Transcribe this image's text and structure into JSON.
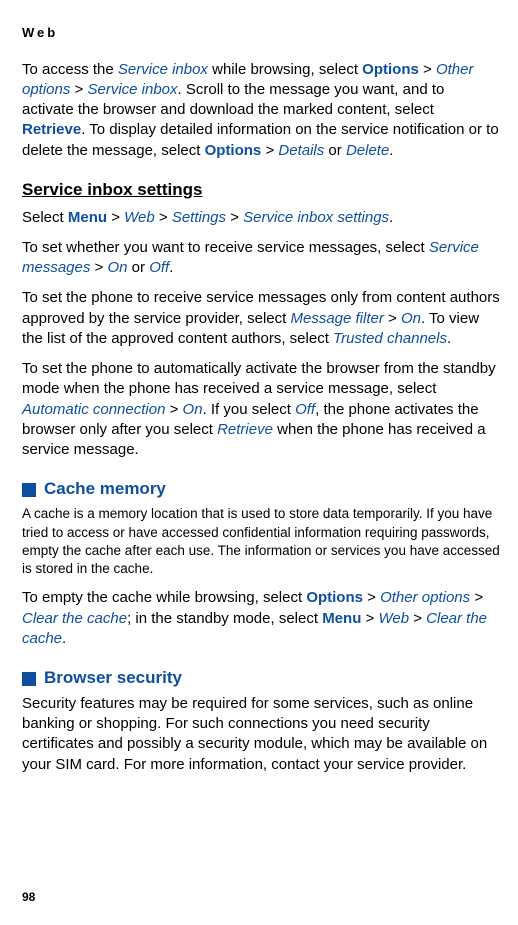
{
  "header": "Web",
  "p1": {
    "t1": "To access the ",
    "link1": "Service inbox",
    "t2": " while browsing, select ",
    "opt": "Options",
    "gt": " > ",
    "link2": "Other options",
    "link3": "Service inbox",
    "t3": ". Scroll to the message you want, and to activate the browser and download the marked content, select ",
    "retrieve": "Retrieve",
    "t4": ". To display detailed information on the service notification or to delete the message, select ",
    "details": "Details",
    "or": " or ",
    "delete": "Delete",
    "dot": "."
  },
  "h1": "Service inbox settings",
  "p2": {
    "t1": "Select ",
    "menu": "Menu",
    "gt": " > ",
    "web": "Web",
    "settings": "Settings",
    "sis": "Service inbox settings",
    "dot": "."
  },
  "p3": {
    "t1": "To set whether you want to receive service messages, select ",
    "sm": "Service messages",
    "gt": " > ",
    "on": "On",
    "or": " or ",
    "off": "Off",
    "dot": "."
  },
  "p4": {
    "t1": "To set the phone to receive service messages only from content authors approved by the service provider, select ",
    "mf": "Message filter",
    "gt": " > ",
    "on": "On",
    "t2": ". To view the list of the approved content authors, select ",
    "tc": "Trusted channels",
    "dot": "."
  },
  "p5": {
    "t1": "To set the phone to automatically activate the browser from the standby mode when the phone has received a service message, select ",
    "ac": "Automatic connection",
    "gt": " > ",
    "on": "On",
    "t2": ". If you select ",
    "off": "Off",
    "t3": ", the phone activates the browser only after you select ",
    "retrieve": "Retrieve",
    "t4": " when the phone has received a service message."
  },
  "h2": "Cache memory",
  "p6": "A cache is a memory location that is used to store data temporarily. If you have tried to access or have accessed confidential information requiring passwords, empty the cache after each use. The information or services you have accessed is stored in the cache.",
  "p7": {
    "t1": "To empty the cache while browsing, select ",
    "opt": "Options",
    "gt": " > ",
    "oo": "Other options",
    "ctc": "Clear the cache",
    "t2": "; in the standby mode, select ",
    "menu": "Menu",
    "web": "Web",
    "ctc2": "Clear the cache",
    "dot": "."
  },
  "h3": "Browser security",
  "p8": "Security features may be required for some services, such as online banking or shopping. For such connections you need security certificates and possibly a security module, which may be available on your SIM card. For more information, contact your service provider.",
  "pagenum": "98"
}
